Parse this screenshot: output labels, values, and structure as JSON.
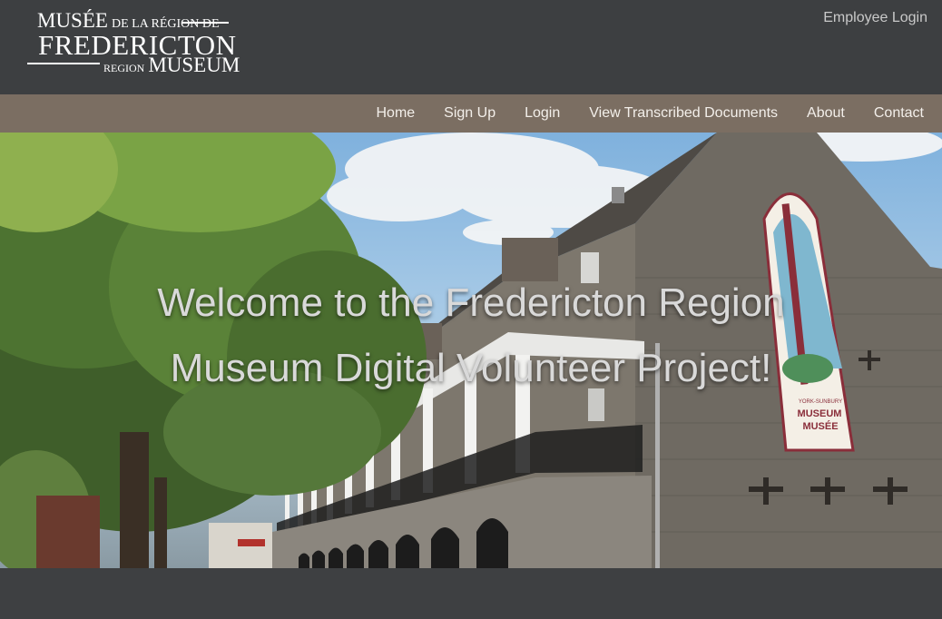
{
  "logo": {
    "line1_big": "MUSÉE",
    "line1_small": "DE LA RÉGION DE",
    "line2": "FREDERICTON",
    "line3_small": "REGION",
    "line3_big": "MUSEUM"
  },
  "header": {
    "employee_login": "Employee Login"
  },
  "nav": {
    "items": [
      {
        "label": "Home"
      },
      {
        "label": "Sign Up"
      },
      {
        "label": "Login"
      },
      {
        "label": "View Transcribed Documents"
      },
      {
        "label": "About"
      },
      {
        "label": "Contact"
      }
    ]
  },
  "hero": {
    "title": "Welcome to the Fredericton Region Museum Digital Volunteer Project!",
    "banner_line1": "YORK-SUNBURY",
    "banner_line2": "MUSEUM",
    "banner_line3": "MUSÉE"
  }
}
